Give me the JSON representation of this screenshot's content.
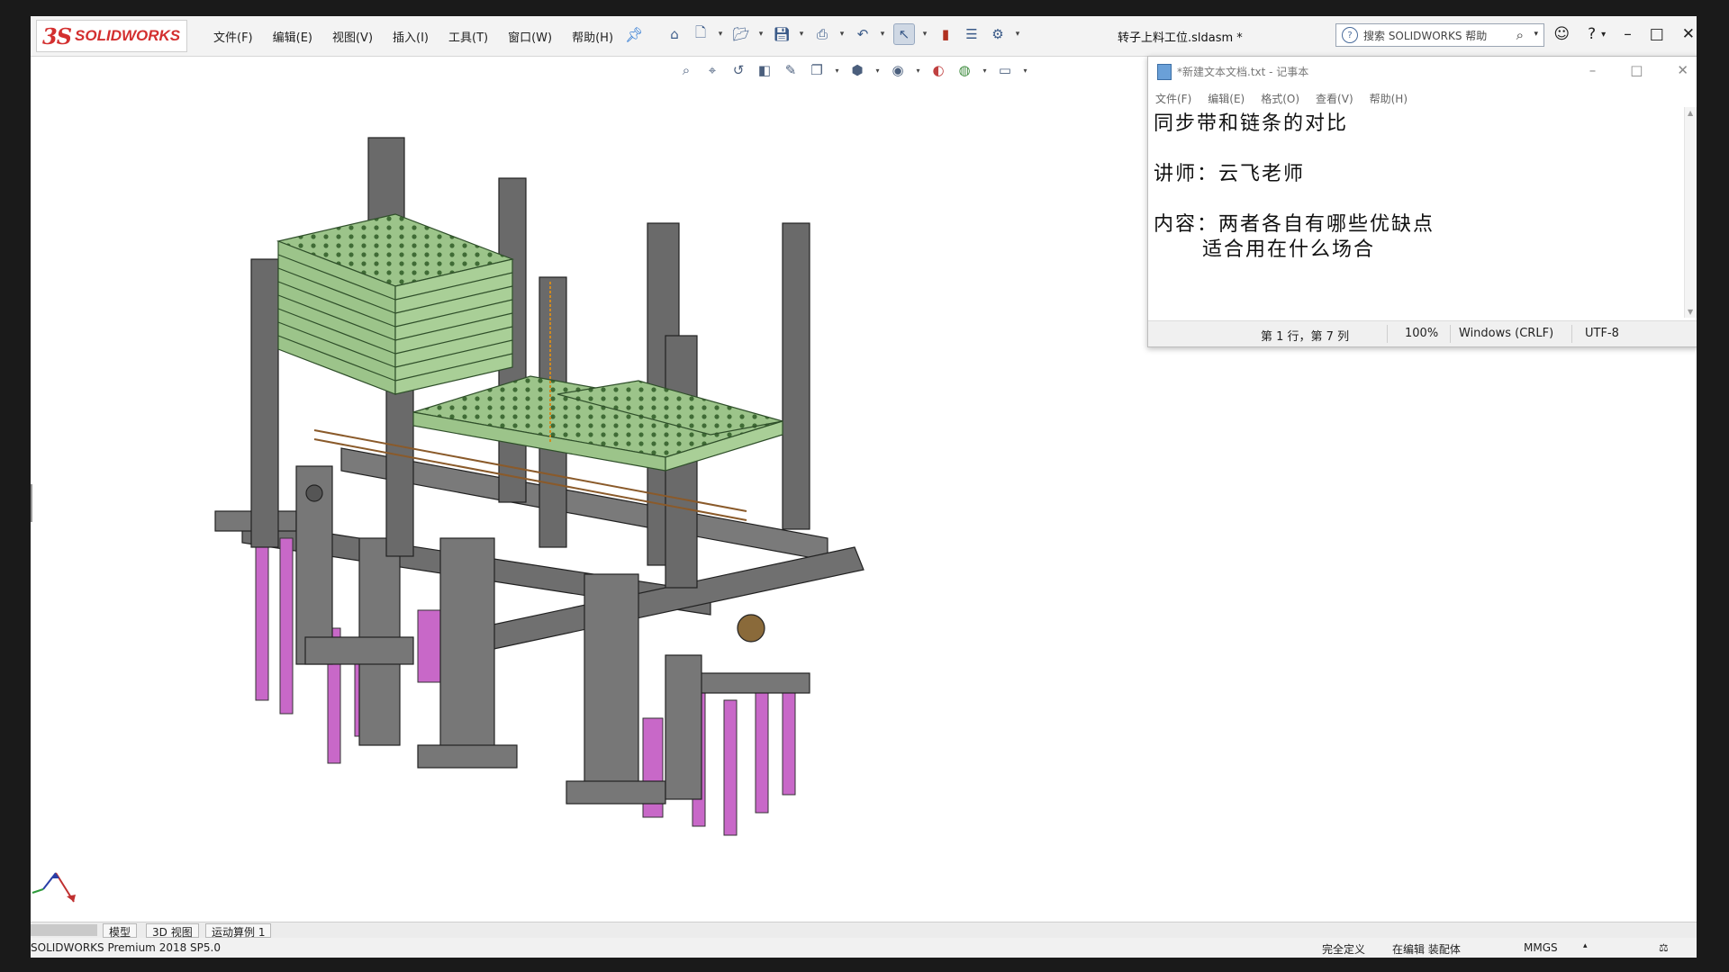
{
  "app": {
    "logo_ds": "3S",
    "logo_text": "SOLIDWORKS",
    "menu": [
      "文件(F)",
      "编辑(E)",
      "视图(V)",
      "插入(I)",
      "工具(T)",
      "窗口(W)",
      "帮助(H)"
    ],
    "document_title": "转子上料工位.sldasm *",
    "search_placeholder": "搜索 SOLIDWORKS 帮助",
    "icons": {
      "pin": "pin-icon",
      "home": "home-icon",
      "new": "new-document-icon",
      "open": "open-folder-icon",
      "save": "save-icon",
      "print": "print-icon",
      "undo": "undo-icon",
      "select": "select-arrow-icon",
      "rebuild": "rebuild-icon",
      "file_properties": "file-properties-icon",
      "options": "gear-icon",
      "help": "help-icon",
      "user": "user-icon"
    }
  },
  "view_toolbar": [
    "zoom-to-fit-icon",
    "zoom-area-icon",
    "previous-view-icon",
    "section-view-icon",
    "dynamic-annotation-icon",
    "view-orientation-icon",
    "display-style-icon",
    "hide-show-icon",
    "edit-appearance-icon",
    "apply-scene-icon",
    "view-settings-icon"
  ],
  "notepad": {
    "title": "*新建文本文档.txt - 记事本",
    "menu": [
      "文件(F)",
      "编辑(E)",
      "格式(O)",
      "查看(V)",
      "帮助(H)"
    ],
    "lines": [
      "同步带和链条的对比",
      "",
      "讲师：云飞老师",
      "",
      "内容：两者各自有哪些优缺点",
      "      适合用在什么场合"
    ],
    "status": {
      "position": "第 1 行，第 7 列",
      "zoom": "100%",
      "line_ending": "Windows (CRLF)",
      "encoding": "UTF-8"
    }
  },
  "tabs": [
    "模型",
    "3D 视图",
    "运动算例 1"
  ],
  "statusbar": {
    "product": "SOLIDWORKS Premium 2018 SP5.0",
    "definition": "完全定义",
    "editing": "在编辑 装配体",
    "units": "MMGS"
  },
  "colors": {
    "frame_gray": "#6e6e6e",
    "tray_green": "#9cc48a",
    "cylinder_magenta": "#c868c8",
    "accent_red": "#d32f2f"
  }
}
